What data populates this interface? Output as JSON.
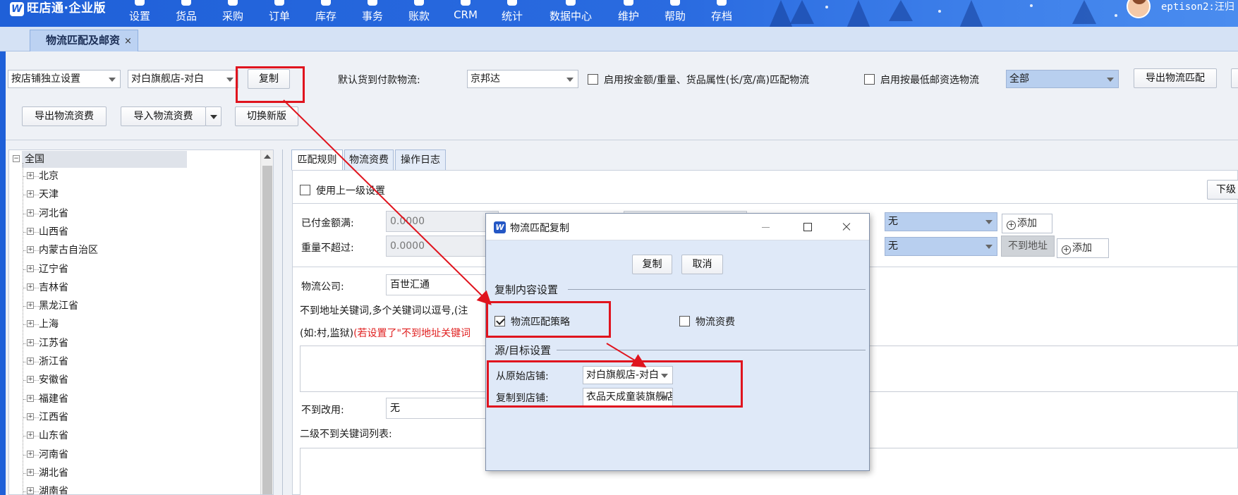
{
  "app": {
    "logo_text": "旺店通·企业版",
    "logo_mark": "W",
    "user_name": "eptison2:汪归"
  },
  "menu": [
    {
      "label": "设置",
      "icon": "gear-icon"
    },
    {
      "label": "货品",
      "icon": "goods-icon"
    },
    {
      "label": "采购",
      "icon": "purchase-icon"
    },
    {
      "label": "订单",
      "icon": "order-icon"
    },
    {
      "label": "库存",
      "icon": "stock-icon"
    },
    {
      "label": "事务",
      "icon": "task-icon"
    },
    {
      "label": "账款",
      "icon": "account-icon"
    },
    {
      "label": "CRM",
      "icon": "crm-icon"
    },
    {
      "label": "统计",
      "icon": "stats-icon"
    },
    {
      "label": "数据中心",
      "icon": "data-center-icon"
    },
    {
      "label": "维护",
      "icon": "maintain-icon"
    },
    {
      "label": "帮助",
      "icon": "help-icon"
    },
    {
      "label": "存档",
      "icon": "archive-icon"
    }
  ],
  "tabs": {
    "active_doc": "物流匹配及邮资",
    "close_glyph": "×"
  },
  "toolbar": {
    "mode_select": "按店铺独立设置",
    "shop_select": "对白旗舰店-对白",
    "copy_button": "复制",
    "cod_label": "默认货到付款物流:",
    "cod_select": "京邦达",
    "match_by_attr_label": "启用按金额/重量、货品属性(长/宽/高)匹配物流",
    "lowest_postage_label": "启用按最低邮资选物流",
    "scope_select": "全部",
    "export_match_button": "导出物流匹配",
    "export_fee_button": "导出物流资费",
    "import_fee_button": "导入物流资费",
    "switch_version_button": "切换新版"
  },
  "tree": {
    "root": "全国",
    "collapse_glyph": "−",
    "expand_glyph": "+",
    "provinces": [
      "北京",
      "天津",
      "河北省",
      "山西省",
      "内蒙古自治区",
      "辽宁省",
      "吉林省",
      "黑龙江省",
      "上海",
      "江苏省",
      "浙江省",
      "安徽省",
      "福建省",
      "江西省",
      "山东省",
      "河南省",
      "湖北省",
      "湖南省"
    ]
  },
  "panel": {
    "tabs": [
      "匹配规则",
      "物流资费",
      "操作日志"
    ],
    "use_parent_label": "使用上一级设置",
    "next_level_button": "下级",
    "paid_amount_label": "已付金额满:",
    "paid_amount_value": "0.0000",
    "weight_label": "重量不超过:",
    "weight_value": "0.0000",
    "none_select_1": "无",
    "none_select_2": "无",
    "add_button": "添加",
    "no_address_button": "不到地址",
    "logistics_label": "物流公司:",
    "logistics_value": "百世汇通",
    "keyword_hint_1": "不到地址关键词,多个关键词以逗号,(注",
    "keyword_hint_2a": "(如:村,监狱)",
    "keyword_hint_2b": "(若设置了\"不到地址关键词",
    "fallback_label": "不到改用:",
    "fallback_value": "无",
    "second_keyword_label": "二级不到关键词列表:"
  },
  "dialog": {
    "icon_mark": "W",
    "title": "物流匹配复制",
    "copy_button": "复制",
    "cancel_button": "取消",
    "content_section": "复制内容设置",
    "strategy_label": "物流匹配策略",
    "strategy_checked": true,
    "fee_label": "物流资费",
    "fee_checked": false,
    "source_section": "源/目标设置",
    "from_shop_label": "从原始店铺:",
    "from_shop_value": "对白旗舰店-对白",
    "to_shop_label": "复制到店铺:",
    "to_shop_value": "衣品天成童装旗舰店"
  },
  "colors": {
    "topbar": "#2264dc",
    "tab_active": "#bcd2f2",
    "annotation_red": "#e0141e",
    "dialog_bg": "#dfe9f8",
    "selected_combo": "#b8cfef"
  }
}
